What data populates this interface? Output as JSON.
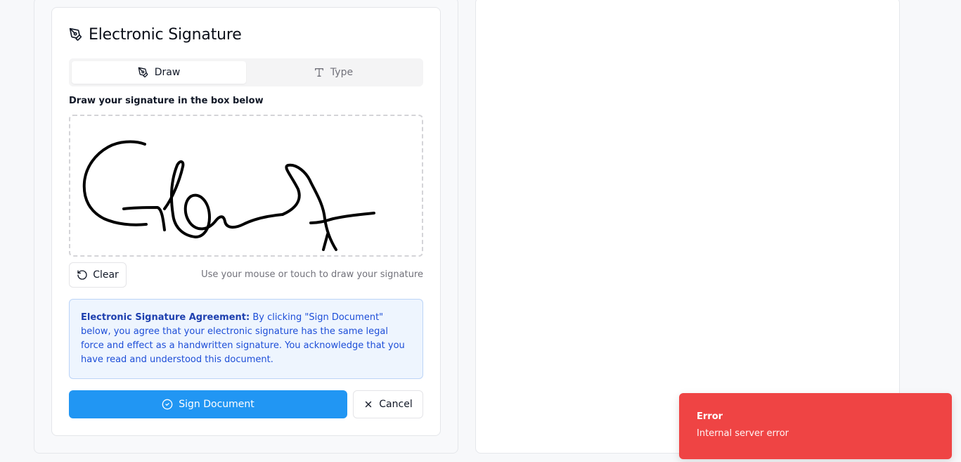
{
  "card": {
    "title": "Electronic Signature",
    "title_icon": "pen-tool-icon"
  },
  "tabs": [
    {
      "label": "Draw",
      "icon": "pen-tool-icon",
      "active": true
    },
    {
      "label": "Type",
      "icon": "type-icon",
      "active": false
    }
  ],
  "draw": {
    "instruction": "Draw your signature in the box below",
    "hint": "Use your mouse or touch to draw your signature",
    "clear_label": "Clear",
    "clear_icon": "rotate-ccw-icon"
  },
  "agreement": {
    "heading": "Electronic Signature Agreement:",
    "body": " By clicking \"Sign Document\" below, you agree that your electronic signature has the same legal force and effect as a handwritten signature. You acknowledge that you have read and understood this document."
  },
  "actions": {
    "sign_label": "Sign Document",
    "sign_icon": "check-circle-icon",
    "cancel_label": "Cancel",
    "cancel_icon": "close-icon"
  },
  "toast": {
    "title": "Error",
    "message": "Internal server error"
  },
  "colors": {
    "primary": "#2196f3",
    "error": "#ef4444",
    "agreement_bg": "#eef5fe",
    "agreement_text": "#1d4ed8"
  }
}
